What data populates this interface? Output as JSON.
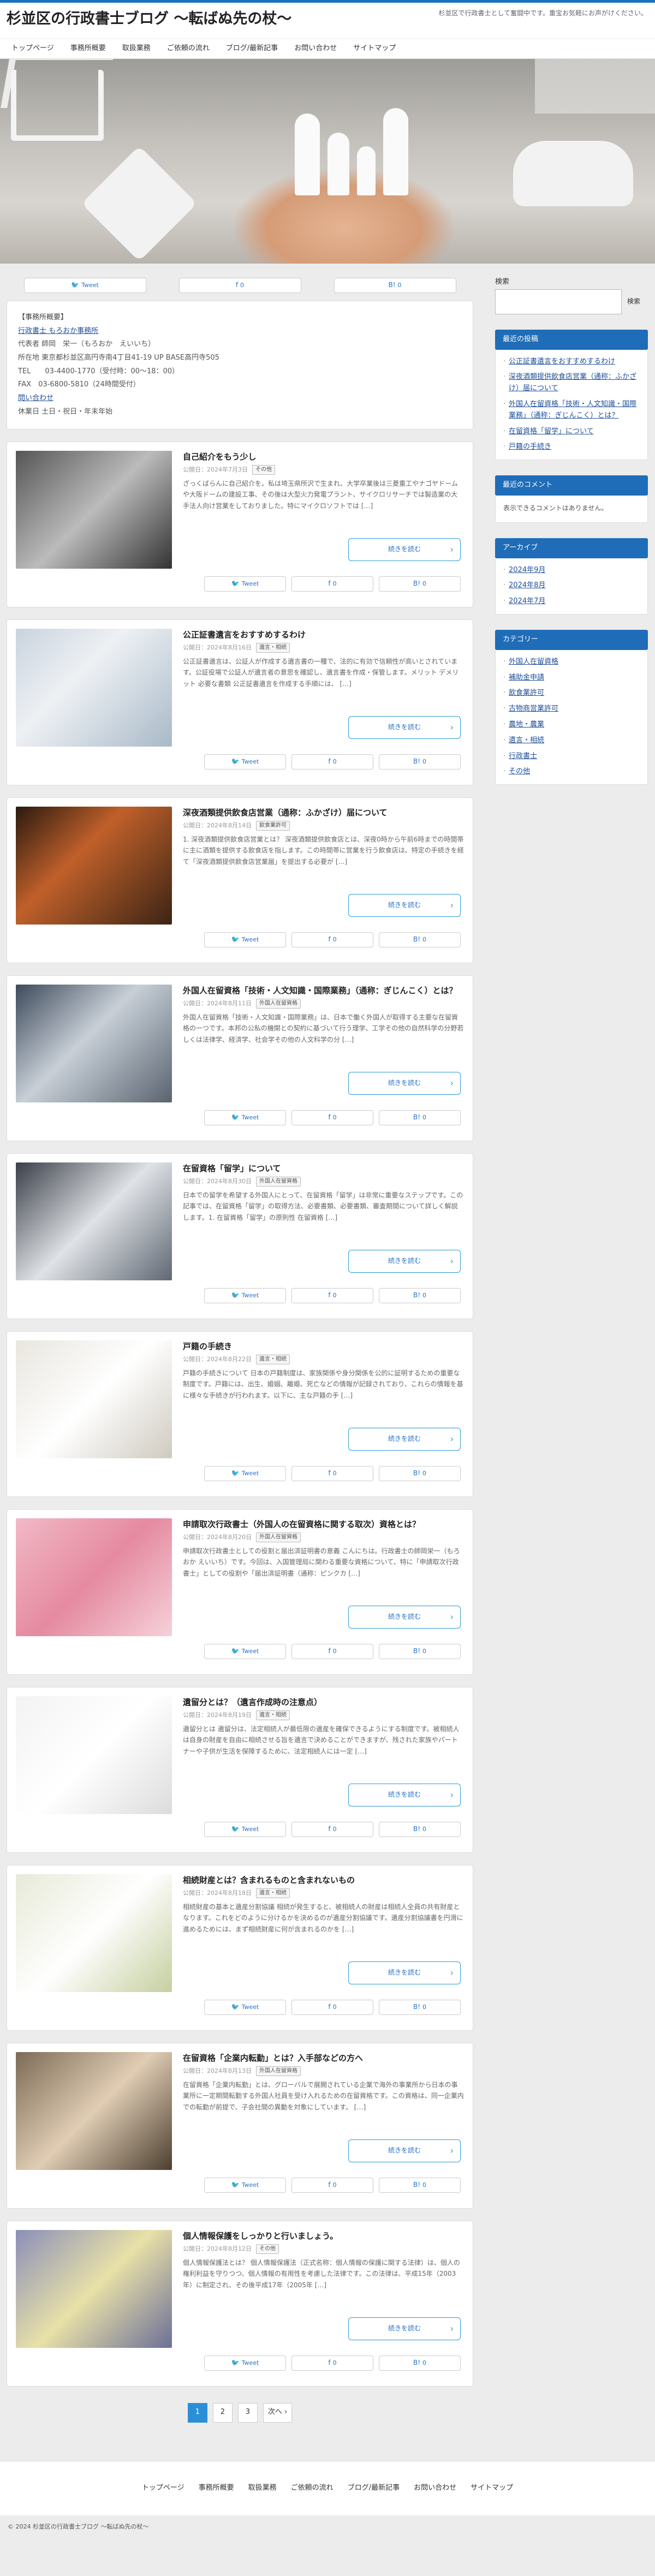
{
  "site": {
    "title": "杉並区の行政書士ブログ 〜転ばぬ先の杖〜",
    "tagline": "杉並区で行政書士として奮闘中です。重宝お気軽にお声がけください。"
  },
  "nav": [
    "トップページ",
    "事務所概要",
    "取扱業務",
    "ご依頼の流れ",
    "ブログ/最新記事",
    "お問い合わせ",
    "サイトマップ"
  ],
  "share": {
    "tweet": "Tweet",
    "like": "0",
    "bookmark": "0"
  },
  "office": {
    "head": "【事務所概要】",
    "name": "行政書士 もろおか事務所",
    "rep": "代表者 師岡　栄一（もろおか　えいいち）",
    "addr": "所在地 東京都杉並区高円寺南4丁目41-19 UP BASE高円寺505",
    "tel": "TEL　　03-4400-1770（受付時：00〜18：00）",
    "fax": "FAX　03-6800-5810（24時間受付）",
    "contact": "問い合わせ",
    "holiday": "休業日 土日・祝日・年末年始"
  },
  "posts": [
    {
      "title": "自己紹介をもう少し",
      "date": "公開日：2024年7月3日",
      "cat": "その他",
      "excerpt": "ざっくばらんに自己紹介を。私は埼玉県所沢で生まれ、大学卒業後は三菱重工やナゴヤドームや大阪ドームの建設工事、その後は大型火力発電プラント、サイクロリサーチでは製造業の大手法人向け営業をしておりました。特にマイクロソフトでは […]"
    },
    {
      "title": "公正証書遺言をおすすめするわけ",
      "date": "公開日：2024年8月16日",
      "cat": "遺言・相続",
      "excerpt": "公正証書遺言は、公証人が作成する遺言書の一種で、法的に有効で信頼性が高いとされています。公証役場で公証人が遺言者の意思を確認し、遺言書を作成・保管します。メリット デメリット 必要な書類 公正証書遺言を作成する手順には、 […]"
    },
    {
      "title": "深夜酒類提供飲食店営業（通称：ふかざけ）届について",
      "date": "公開日：2024年8月14日",
      "cat": "飲食業許可",
      "excerpt": "1. 深夜酒類提供飲食店営業とは？ 深夜酒類提供飲食店とは、深夜0時から午前6時までの時間帯に主に酒類を提供する飲食店を指します。この時間帯に営業を行う飲食店は、特定の手続きを経て「深夜酒類提供飲食店営業届」を提出する必要が […]"
    },
    {
      "title": "外国人在留資格「技術・人文知識・国際業務」（通称：ぎじんこく）とは？",
      "date": "公開日：2024年8月11日",
      "cat": "外国人在留資格",
      "excerpt": "外国人在留資格「技術・人文知識・国際業務」は、日本で働く外国人が取得する主要な在留資格の一つです。本邦の公私の機関との契約に基づいて行う理学、工学その他の自然科学の分野若しくは法律学、経済学、社会学その他の人文科学の分 […]"
    },
    {
      "title": "在留資格「留学」について",
      "date": "公開日：2024年8月30日",
      "cat": "外国人在留資格",
      "excerpt": "日本での留学を希望する外国人にとって、在留資格「留学」は非常に重要なステップです。この記事では、在留資格「留学」の取得方法、必要書類、必要書類、審査期間について詳しく解説します。1. 在留資格「留学」の原則性 在留資格 […]"
    },
    {
      "title": "戸籍の手続き",
      "date": "公開日：2024年8月22日",
      "cat": "遺言・相続",
      "excerpt": "戸籍の手続きについて 日本の戸籍制度は、家族関係や身分関係を公的に証明するための重要な制度です。戸籍には、出生、婚姻、離婚、死亡などの情報が記録されており、これらの情報を基に様々な手続きが行われます。以下に、主な戸籍の手 […]"
    },
    {
      "title": "申請取次行政書士（外国人の在留資格に関する取次）資格とは？",
      "date": "公開日：2024年8月20日",
      "cat": "外国人在留資格",
      "excerpt": "申請取次行政書士としての役割と届出済証明書の意義 こんにちは。行政書士の師岡栄一（もろおか えいいち）です。今回は、入国管理局に関わる重要な資格について、特に「申請取次行政書士」としての役割や「届出済証明書（通称：ピンクカ […]"
    },
    {
      "title": "遺留分とは？（遺言作成時の注意点）",
      "date": "公開日：2024年8月19日",
      "cat": "遺言・相続",
      "excerpt": "遺留分とは 遺留分は、法定相続人が最低限の遺産を確保できるようにする制度です。被相続人は自身の財産を自由に相続させる旨を遺言で決めることができますが、残された家族やパートナーや子供が生活を保障するために、法定相続人には一定 […]"
    },
    {
      "title": "相続財産とは？含まれるものと含まれないもの",
      "date": "公開日：2024年8月18日",
      "cat": "遺言・相続",
      "excerpt": "相続財産の基本と遺産分割協議 相続が発生すると、被相続人の財産は相続人全員の共有財産となります。これをどのように分けるかを決めるのが遺産分割協議です。遺産分割協議書を円滑に進めるためには、まず相続財産に何が含まれるのかを […]"
    },
    {
      "title": "在留資格「企業内転勤」とは？入手部などの方へ",
      "date": "公開日：2024年8月13日",
      "cat": "外国人在留資格",
      "excerpt": "在留資格「企業内転勤」とは、グローバルで展開されている企業で海外の事業所から日本の事業所に一定期間転勤する外国人社員を受け入れるための在留資格です。この資格は、同一企業内での転勤が前提で、子会社間の異動を対象にしています。 […]"
    },
    {
      "title": "個人情報保護をしっかりと行いましょう。",
      "date": "公開日：2024年8月12日",
      "cat": "その他",
      "excerpt": "個人情報保護法とは？ 個人情報保護法（正式名称：個人情報の保護に関する法律）は、個人の権利利益を守りつつ、個人情報の有用性を考慮した法律です。この法律は、平成15年（2003年）に制定され、その後平成17年（2005年 […]"
    }
  ],
  "more_label": "続きを読む",
  "pager": {
    "pages": [
      "1",
      "2",
      "3"
    ],
    "next": "次へ ›"
  },
  "sidebar": {
    "search_label": "検索",
    "search_button": "検索",
    "recent_title": "最近の投稿",
    "recent": [
      "公正証書遺言をおすすめするわけ",
      "深夜酒類提供飲食店営業（通称：ふかざけ）届について",
      "外国人在留資格「技術・人文知識・国際業務」（通称：ぎじんこく）とは？",
      "在留資格「留学」について",
      "戸籍の手続き"
    ],
    "comments_title": "最近のコメント",
    "comments_empty": "表示できるコメントはありません。",
    "archive_title": "アーカイブ",
    "archive": [
      "2024年9月",
      "2024年8月",
      "2024年7月"
    ],
    "category_title": "カテゴリー",
    "categories": [
      "外国人在留資格",
      "補助金申請",
      "飲食業許可",
      "古物商営業許可",
      "農地・農業",
      "遺言・相続",
      "行政書士",
      "その他"
    ]
  },
  "footer": {
    "nav": [
      "トップページ",
      "事務所概要",
      "取扱業務",
      "ご依頼の流れ",
      "ブログ/最新記事",
      "お問い合わせ",
      "サイトマップ"
    ],
    "copy": "© 2024 杉並区の行政書士ブログ 〜転ばぬ先の杖〜"
  },
  "colors": {
    "accent": "#1f6db8",
    "button_border": "#2b9bd6"
  }
}
